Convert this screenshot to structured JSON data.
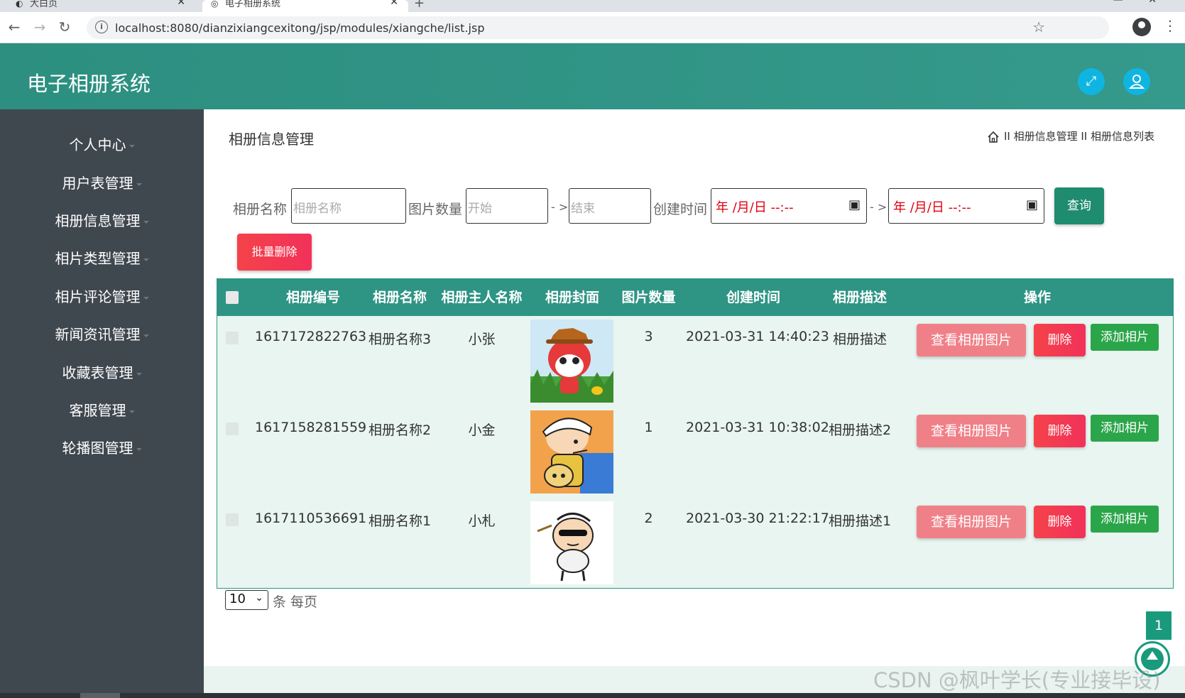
{
  "browser": {
    "tabs": [
      {
        "title": "大白页"
      },
      {
        "title": "电子相册系统"
      }
    ],
    "url": "localhost:8080/dianzixiangcexitong/jsp/modules/xiangche/list.jsp"
  },
  "app": {
    "title": "电子相册系统"
  },
  "sidebar": {
    "items": [
      {
        "label": "个人中心"
      },
      {
        "label": "用户表管理"
      },
      {
        "label": "相册信息管理"
      },
      {
        "label": "相片类型管理"
      },
      {
        "label": "相片评论管理"
      },
      {
        "label": "新闻资讯管理"
      },
      {
        "label": "收藏表管理"
      },
      {
        "label": "客服管理"
      },
      {
        "label": "轮播图管理"
      }
    ]
  },
  "page": {
    "title": "相册信息管理",
    "breadcrumb": "II 相册信息管理 II 相册信息列表"
  },
  "search": {
    "name_label": "相册名称",
    "name_placeholder": "相册名称",
    "count_label": "图片数量",
    "count_start_placeholder": "开始",
    "count_end_placeholder": "结束",
    "range_sep": "- >",
    "time_label": "创建时间",
    "date_placeholder": "年 /月/日 --:--",
    "query_button": "查询",
    "batch_delete_button": "批量删除"
  },
  "table": {
    "headers": [
      "相册编号",
      "相册名称",
      "相册主人名称",
      "相册封面",
      "图片数量",
      "创建时间",
      "相册描述",
      "操作"
    ],
    "rows": [
      {
        "id": "1617172822763",
        "name": "相册名称3",
        "owner": "小张",
        "cover": "red-fox-cartoon",
        "count": "3",
        "created": "2021-03-31 14:40:23",
        "desc": "相册描述"
      },
      {
        "id": "1617158281559",
        "name": "相册名称2",
        "owner": "小金",
        "cover": "boy-with-backpack-cartoon",
        "count": "1",
        "created": "2021-03-31 10:38:02",
        "desc": "相册描述2"
      },
      {
        "id": "1617110536691",
        "name": "相册名称1",
        "owner": "小札",
        "cover": "boy-sunglasses-cartoon",
        "count": "2",
        "created": "2021-03-30 21:22:17",
        "desc": "相册描述1"
      }
    ],
    "actions": {
      "view": "查看相册图片",
      "delete": "删除",
      "add": "添加相片"
    }
  },
  "pagination": {
    "page_size": "10",
    "page_size_label": "条 每页",
    "current_page": "1"
  },
  "watermark": "CSDN @枫叶学长(专业接毕设)",
  "colors": {
    "primary": "#2e9484",
    "sidebar": "#3f474f",
    "danger": "#f2315a",
    "success": "#2ba54a",
    "view": "#f08088"
  }
}
